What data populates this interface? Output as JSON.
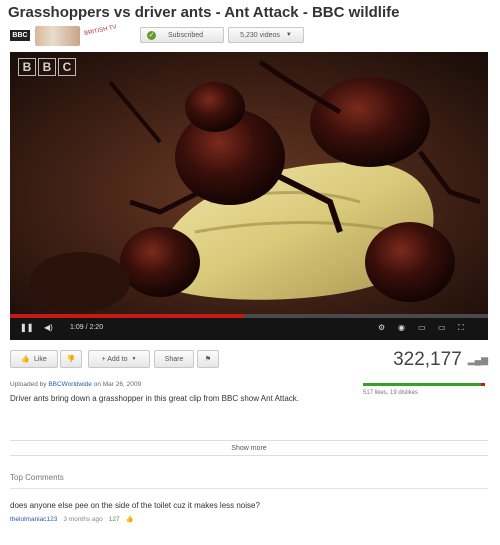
{
  "video": {
    "title": "Grasshoppers vs driver ants - Ant Attack - BBC wildlife"
  },
  "channel": {
    "logo_text": "BBC",
    "secondary_label": "BRITISH TV",
    "subscribe_label": "Subscribed",
    "videos_label": "5,230 videos"
  },
  "player": {
    "watermark": [
      "B",
      "B",
      "C"
    ],
    "time": "1:09 / 2:20",
    "progress": 0.49
  },
  "actions": {
    "like_label": "Like",
    "add_to_label": "+ Add to",
    "share_label": "Share",
    "views": "322,177",
    "like_ratio": 0.965,
    "likes_dislikes": "517 likes, 19 dislikes"
  },
  "description": {
    "uploaded_prefix": "Uploaded by",
    "uploader": "BBCWorldwide",
    "uploaded_date": "on Mar 26, 2009",
    "text": "Driver ants bring down a grasshopper in this great clip from BBC show Ant Attack.",
    "show_more": "Show more"
  },
  "comments": {
    "heading": "Top Comments",
    "items": [
      {
        "text": "does anyone else pee on the side of the toilet cuz it makes less noise?",
        "author": "thelolmaniac123",
        "time": "3 months ago",
        "votes": "127"
      }
    ]
  },
  "colors": {
    "progress_red": "#c41b17",
    "like_green": "#3a9e2a",
    "link_blue": "#2b5aa8"
  }
}
